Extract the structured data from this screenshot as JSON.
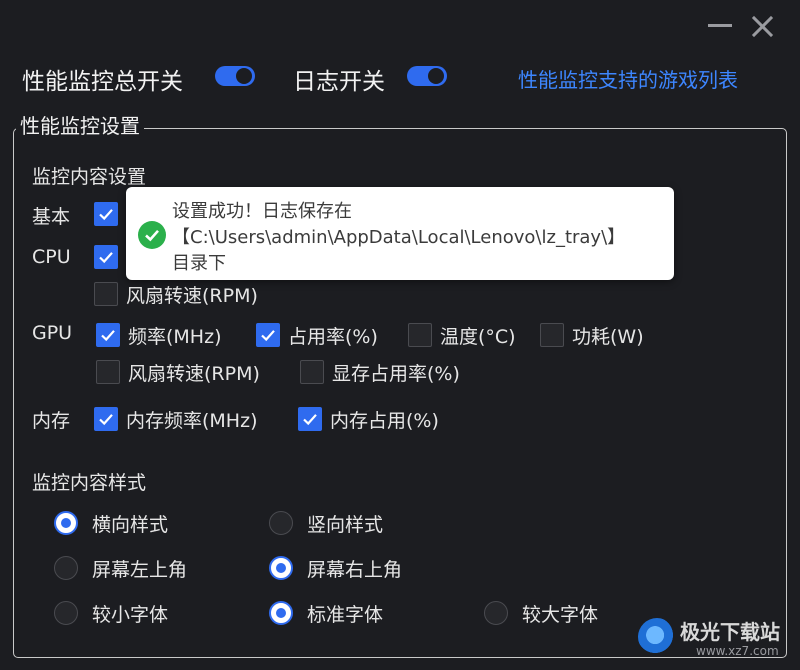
{
  "header": {
    "master_switch_label": "性能监控总开关",
    "master_switch_on": true,
    "log_switch_label": "日志开关",
    "log_switch_on": true,
    "supported_games_link": "性能监控支持的游戏列表"
  },
  "settings": {
    "group_title": "性能监控设置",
    "content_section_title": "监控内容设置",
    "rows": {
      "basic": {
        "label": "基本",
        "items": [
          {
            "label": "",
            "checked": true
          }
        ]
      },
      "cpu": {
        "label": "CPU",
        "items": [
          {
            "label": "",
            "checked": true
          },
          {
            "label": "风扇转速(RPM)",
            "checked": false
          }
        ]
      },
      "gpu": {
        "label": "GPU",
        "items": [
          {
            "label": "频率(MHz)",
            "checked": true
          },
          {
            "label": "占用率(%)",
            "checked": true
          },
          {
            "label": "温度(°C)",
            "checked": false
          },
          {
            "label": "功耗(W)",
            "checked": false
          },
          {
            "label": "风扇转速(RPM)",
            "checked": false
          },
          {
            "label": "显存占用率(%)",
            "checked": false
          }
        ]
      },
      "memory": {
        "label": "内存",
        "items": [
          {
            "label": "内存频率(MHz)",
            "checked": true
          },
          {
            "label": "内存占用(%)",
            "checked": true
          }
        ]
      }
    },
    "style_section_title": "监控内容样式",
    "orientation": {
      "options": [
        "横向样式",
        "竖向样式"
      ],
      "selected": "横向样式"
    },
    "position": {
      "options": [
        "屏幕左上角",
        "屏幕右上角"
      ],
      "selected": "屏幕右上角"
    },
    "font_size": {
      "options": [
        "较小字体",
        "标准字体",
        "较大字体"
      ],
      "selected": "标准字体"
    }
  },
  "toast": {
    "line1": "设置成功！日志保存在",
    "line2": "【C:\\Users\\admin\\AppData\\Local\\Lenovo\\lz_tray\\】",
    "line3": "目录下",
    "icon": "success-check-icon"
  },
  "watermark": {
    "title": "极光下载站",
    "url": "www.xz7.com"
  },
  "colors": {
    "background": "#1c1d21",
    "accent": "#2f6bef",
    "link": "#3d86ff",
    "success": "#2bb04b"
  }
}
